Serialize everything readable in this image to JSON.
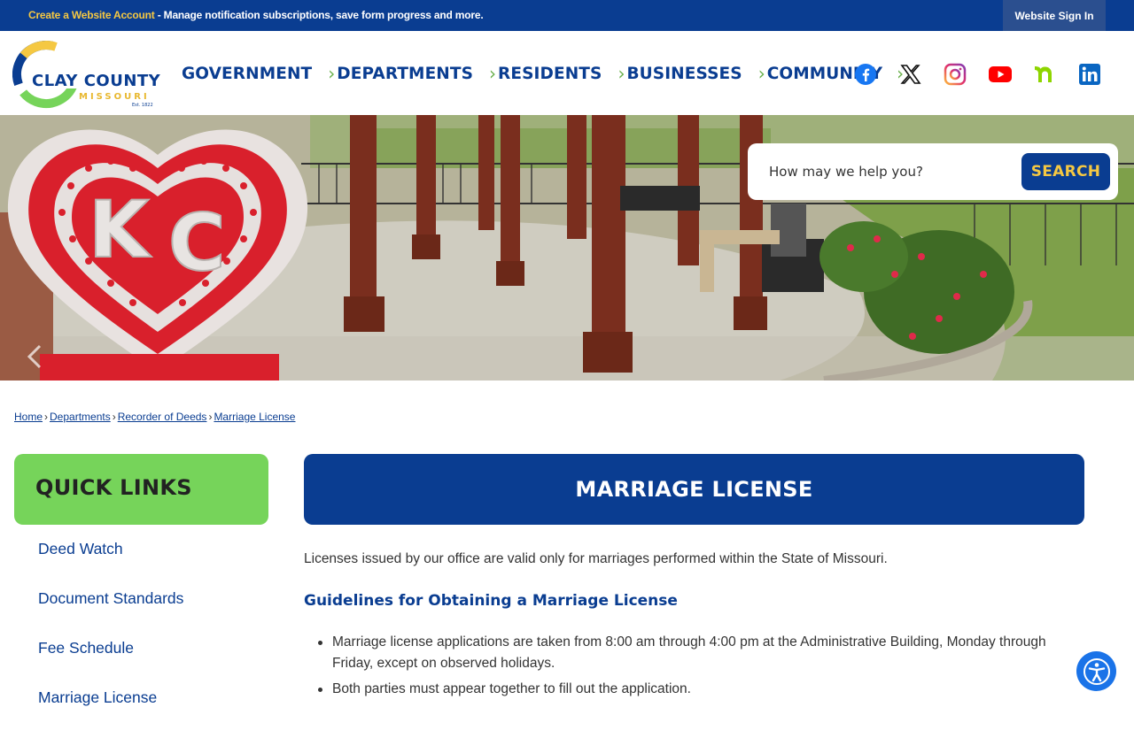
{
  "topbar": {
    "account_link": "Create a Website Account",
    "message": " - Manage notification subscriptions, save form progress and more.",
    "signin_label": "Website Sign In"
  },
  "logo": {
    "line1": "CLAY COUNTY",
    "line2": "MISSOURI",
    "est": "Est. 1822"
  },
  "nav": {
    "items": [
      "GOVERNMENT",
      "DEPARTMENTS",
      "RESIDENTS",
      "BUSINESSES",
      "COMMUNITY"
    ]
  },
  "socials": [
    "facebook-icon",
    "x-icon",
    "instagram-icon",
    "youtube-icon",
    "nextdoor-icon",
    "linkedin-icon"
  ],
  "search": {
    "placeholder": "How may we help you?",
    "button_label": "SEARCH"
  },
  "breadcrumb": {
    "items": [
      "Home",
      "Departments",
      "Recorder of Deeds",
      "Marriage License"
    ],
    "separator": "›"
  },
  "sidebar": {
    "title": "QUICK LINKS",
    "items": [
      "Deed Watch",
      "Document Standards",
      "Fee Schedule",
      "Marriage License"
    ]
  },
  "main": {
    "title": "MARRIAGE LICENSE",
    "intro": "Licenses issued by our office are valid only for marriages performed within the State of Missouri.",
    "subheading": "Guidelines for Obtaining a Marriage License",
    "bullets": [
      "Marriage license applications are taken from 8:00 am through 4:00 pm at the Administrative Building, Monday through Friday, except on observed holidays.",
      "Both parties must appear together to fill out the application."
    ]
  },
  "colors": {
    "brand_blue": "#0a3d91",
    "accent_green": "#76d45a",
    "accent_yellow": "#f5c842"
  }
}
